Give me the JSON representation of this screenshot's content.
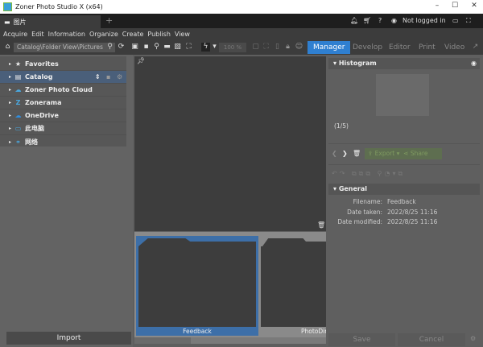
{
  "window": {
    "title": "Zoner Photo Studio X (x64)",
    "minimize": "–",
    "maximize": "☐",
    "close": "✕"
  },
  "tab": {
    "label": "图片",
    "add": "+"
  },
  "header_right": {
    "user": "Not logged in"
  },
  "menu": [
    "Acquire",
    "Edit",
    "Information",
    "Organize",
    "Create",
    "Publish",
    "View"
  ],
  "toolbar": {
    "path": "Catalog\\Folder View\\Pictures",
    "zoom": "100 %"
  },
  "modes": [
    "Manager",
    "Develop",
    "Editor",
    "Print",
    "Video"
  ],
  "tree": [
    {
      "label": "Favorites",
      "icon": "star-icon"
    },
    {
      "label": "Catalog",
      "icon": "catalog-icon"
    },
    {
      "label": "Zoner Photo Cloud",
      "icon": "cloud-icon"
    },
    {
      "label": "Zonerama",
      "icon": "zonerama-icon"
    },
    {
      "label": "OneDrive",
      "icon": "onedrive-icon"
    },
    {
      "label": "此电脑",
      "icon": "computer-icon"
    },
    {
      "label": "网络",
      "icon": "network-icon"
    }
  ],
  "import_label": "Import",
  "filmstrip": [
    {
      "label": "Feedback",
      "selected": true
    },
    {
      "label": "PhotoDir",
      "selected": false
    }
  ],
  "right": {
    "histogram": "Histogram",
    "counter": "(1/5)",
    "export": "Export",
    "share": "Share",
    "general": "General",
    "fields": [
      {
        "key": "Filename:",
        "value": "Feedback"
      },
      {
        "key": "Date taken:",
        "value": "2022/8/25 11:16"
      },
      {
        "key": "Date modified:",
        "value": "2022/8/25 11:16"
      }
    ],
    "save": "Save",
    "cancel": "Cancel"
  },
  "colors": {
    "accent": "#2f7fd0"
  }
}
